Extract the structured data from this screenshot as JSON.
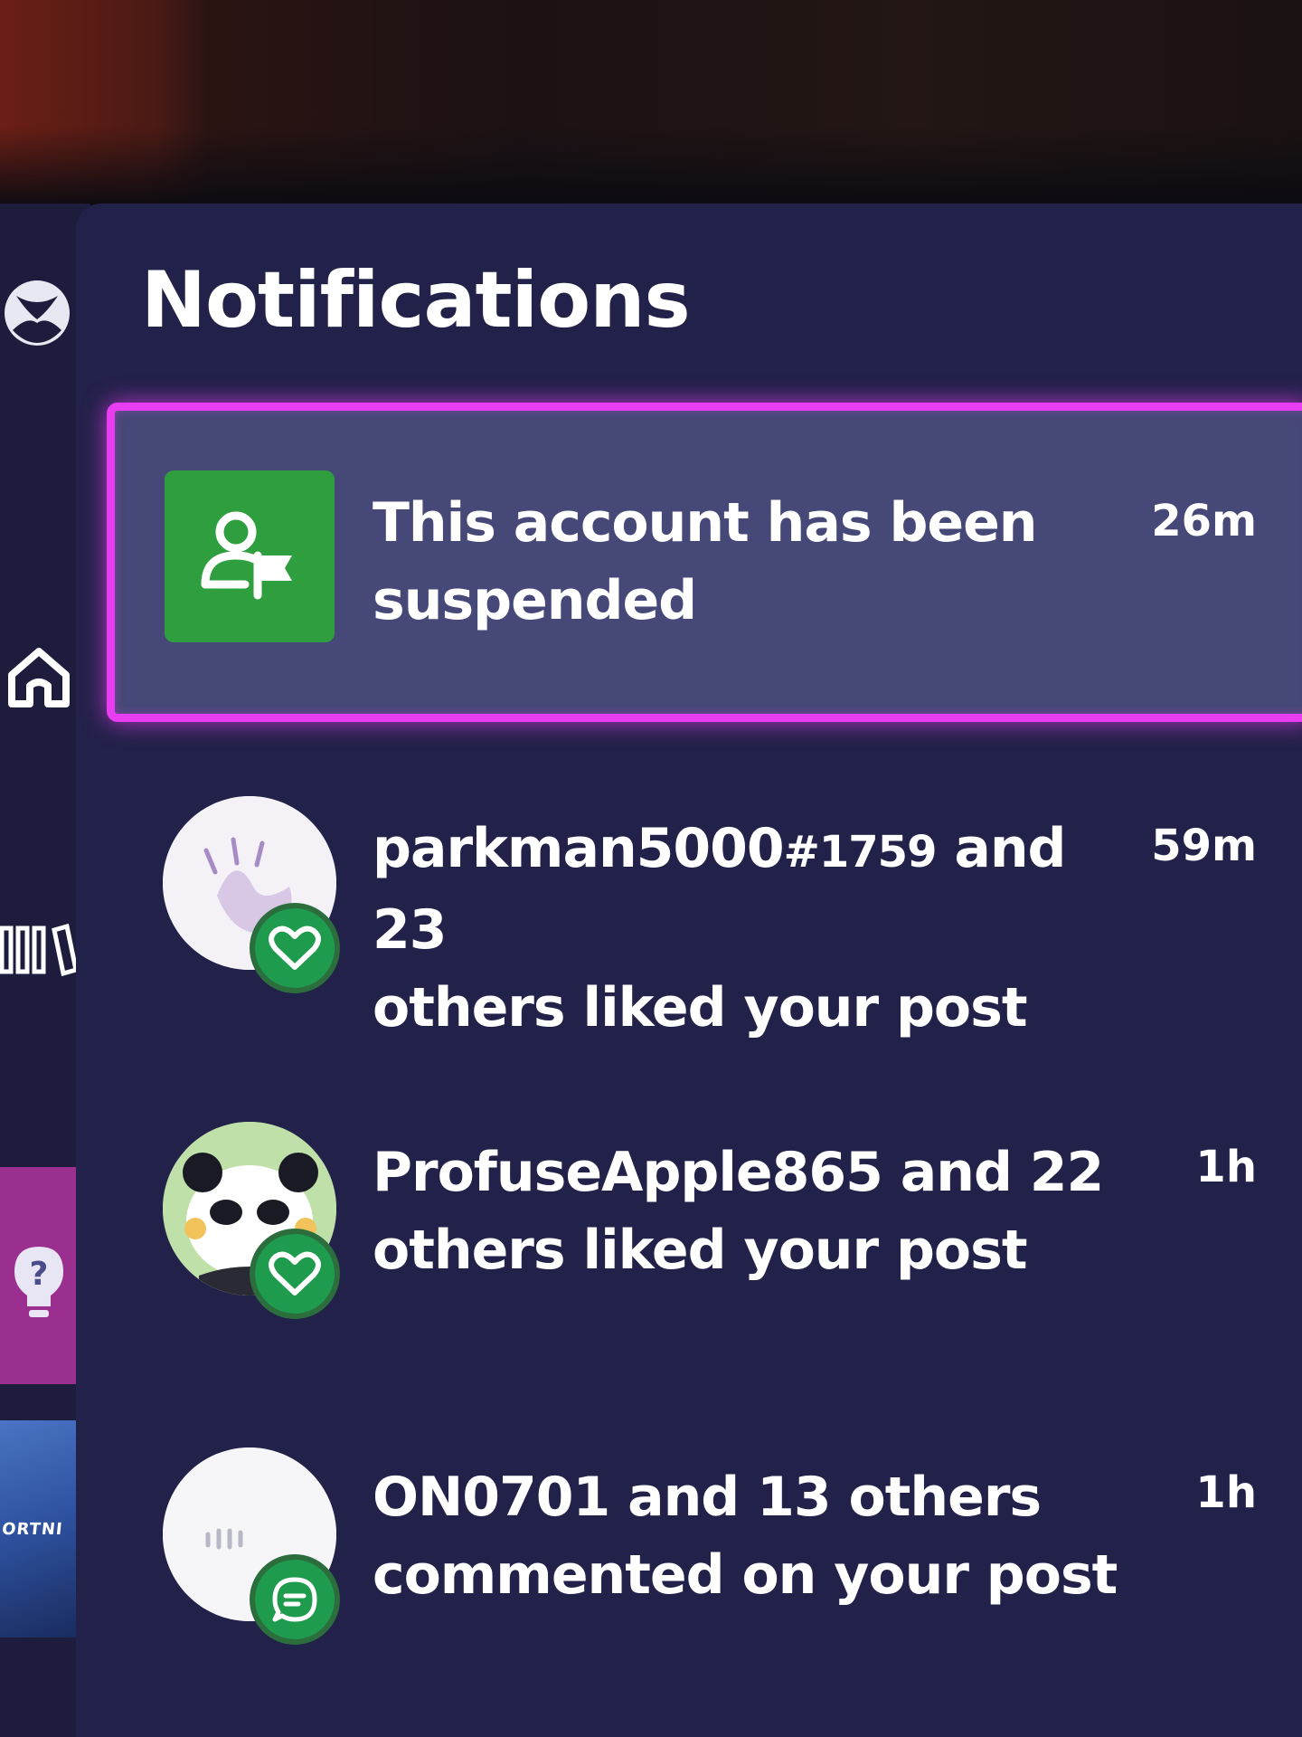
{
  "panel": {
    "title": "Notifications"
  },
  "rail": {
    "items": [
      {
        "name": "xbox-logo-icon"
      },
      {
        "name": "home-icon"
      },
      {
        "name": "library-icon"
      },
      {
        "name": "tips-icon"
      }
    ],
    "thumbnail_label": "ORTNI"
  },
  "notifications": [
    {
      "text_line1": "This account has been",
      "text_line2": "suspended",
      "time": "26m",
      "icon": "account-flag-icon",
      "selected": true
    },
    {
      "gamertag": "parkman5000",
      "gamertag_suffix": "#1759",
      "text_line1_rest": " and 23",
      "text_line2": "others liked your post",
      "time": "59m",
      "badge": "heart-icon"
    },
    {
      "gamertag": "ProfuseApple865",
      "text_line1_rest": " and 22",
      "text_line2": "others liked your post",
      "time": "1h",
      "badge": "heart-icon"
    },
    {
      "gamertag": "ON0701",
      "text_line1_rest": " and 13 others",
      "text_line2": "commented on your post",
      "time": "1h",
      "badge": "comment-icon"
    }
  ],
  "colors": {
    "panel_bg": "#222149",
    "selected_bg": "#464877",
    "focus_border": "#e83df0",
    "badge_green": "#1e9b4d",
    "icon_green": "#2e9e3e"
  }
}
